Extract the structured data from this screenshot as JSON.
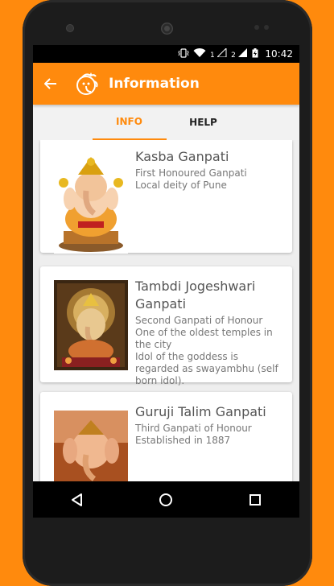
{
  "statusbar": {
    "vibrate_icon": "vibrate-icon",
    "wifi_icon": "wifi-icon",
    "sim1_label": "1",
    "sim2_label": "2",
    "battery_icon": "battery-charging-icon",
    "time": "10:42"
  },
  "appbar": {
    "title": "Information",
    "back_icon": "arrow-back-icon",
    "logo_icon": "ganesha-logo-icon"
  },
  "tabs": [
    {
      "label": "INFO",
      "active": true
    },
    {
      "label": "HELP",
      "active": false
    }
  ],
  "cards": [
    {
      "title": "Kasba Ganpati",
      "lines": [
        "First Honoured Ganpati",
        "Local deity of Pune"
      ]
    },
    {
      "title": "Tambdi Jogeshwari Ganpati",
      "lines": [
        "Second Ganpati of Honour",
        "One of the oldest temples in the city",
        "Idol of the goddess is regarded as swayambhu (self born idol)."
      ]
    },
    {
      "title": "Guruji Talim Ganpati",
      "lines": [
        "Third Ganpati of Honour",
        "Established in 1887"
      ]
    }
  ],
  "navbar": {
    "back_icon": "nav-back-icon",
    "home_icon": "nav-home-icon",
    "recents_icon": "nav-recents-icon"
  },
  "colors": {
    "accent": "#FF8A0D",
    "background": "#FF8A0D"
  }
}
